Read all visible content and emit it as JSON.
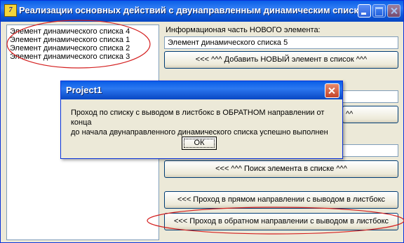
{
  "window": {
    "title": "Реализации основных действий с двунаправленным динамическим списком"
  },
  "listbox": {
    "items": [
      "Элемент динамического списка 4",
      "Элемент динамического списка 1",
      "Элемент динамического списка 2",
      "Элемент динамического списка 3"
    ]
  },
  "form": {
    "info_label": "Информационая часть НОВОГО элемента:",
    "info_value": "Элемент динамического списка 5",
    "add_button": "<<< ^^^ Добавить НОВЫЙ элемент в список ^^^",
    "partial_button_caret": "^^",
    "search_button": "<<< ^^^ Поиск элемента в списке ^^^",
    "forward_button": "<<< Проход в прямом направлении с выводом в листбокс",
    "backward_button": "<<< Проход в обратном направлении с выводом в листбокс"
  },
  "dialog": {
    "title": "Project1",
    "message_line1": "Проход по списку с выводом в листбокс в ОБРАТНОМ направлении от конца",
    "message_line2": "до начала двунаправленного динамического списка успешно выполнен",
    "ok_label": "ОК"
  },
  "colors": {
    "titlebar": "#0a5fe7",
    "annotation": "#d42020",
    "face": "#ece9d8"
  }
}
